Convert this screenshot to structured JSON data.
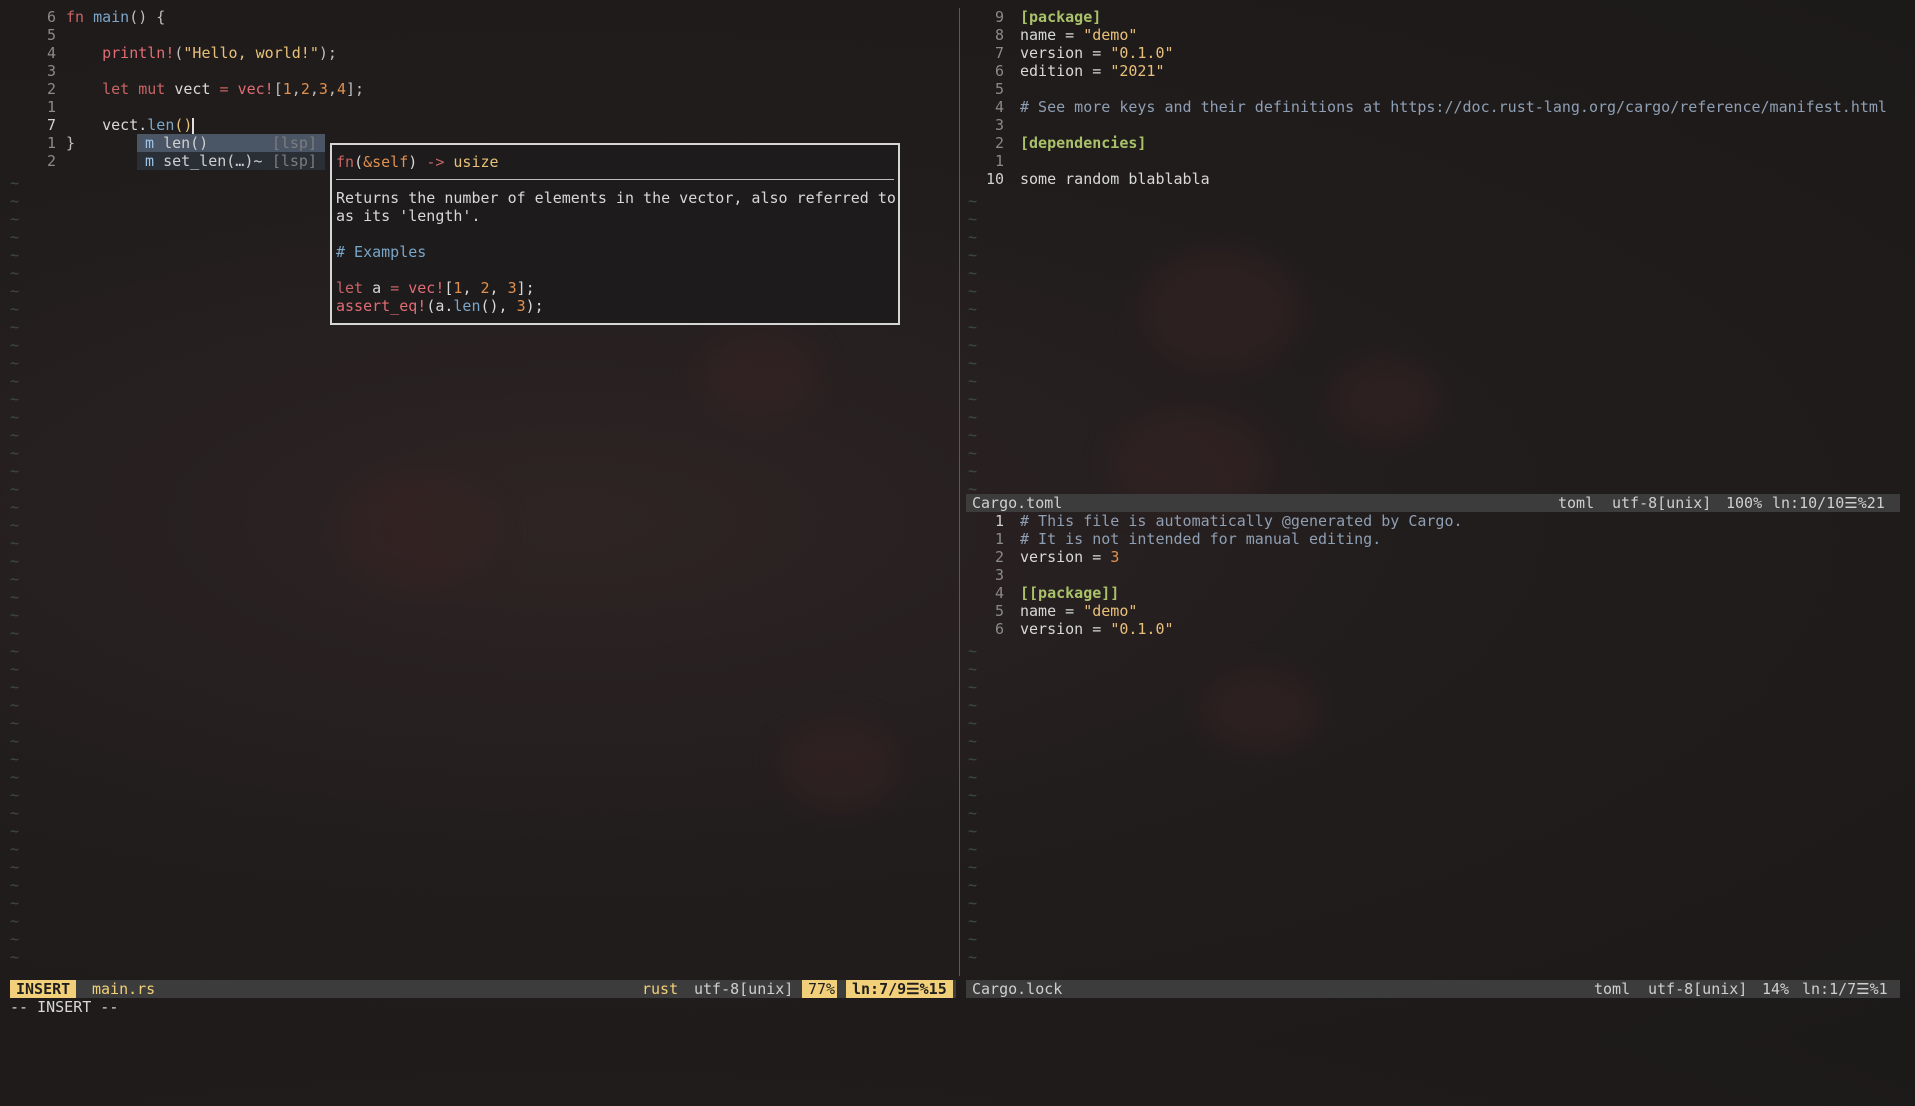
{
  "colors": {
    "accent": "#f2d07a",
    "statusbar": "#3c3c3c",
    "background": "#221d1d"
  },
  "left_pane": {
    "lines": [
      {
        "n": "6",
        "segs": [
          {
            "t": "fn ",
            "c": "kw"
          },
          {
            "t": "main",
            "c": "fn"
          },
          {
            "t": "() {",
            "c": "pun"
          }
        ]
      },
      {
        "n": "5",
        "segs": []
      },
      {
        "n": "4",
        "segs": [
          {
            "t": "    println!",
            "c": "mac"
          },
          {
            "t": "(",
            "c": "pun"
          },
          {
            "t": "\"Hello, world!\"",
            "c": "str"
          },
          {
            "t": ");",
            "c": "pun"
          }
        ]
      },
      {
        "n": "3",
        "segs": []
      },
      {
        "n": "2",
        "segs": [
          {
            "t": "    let mut ",
            "c": "kw"
          },
          {
            "t": "vect ",
            "c": ""
          },
          {
            "t": "= ",
            "c": "kw"
          },
          {
            "t": "vec!",
            "c": "mac"
          },
          {
            "t": "[",
            "c": "pun"
          },
          {
            "t": "1",
            "c": "nm"
          },
          {
            "t": ",",
            "c": "pun"
          },
          {
            "t": "2",
            "c": "nm"
          },
          {
            "t": ",",
            "c": "pun"
          },
          {
            "t": "3",
            "c": "nm"
          },
          {
            "t": ",",
            "c": "pun"
          },
          {
            "t": "4",
            "c": "nm"
          },
          {
            "t": "];",
            "c": "pun"
          }
        ]
      },
      {
        "n": "1",
        "segs": []
      },
      {
        "n": "7",
        "cur": true,
        "segs": [
          {
            "t": "    vect.",
            "c": ""
          },
          {
            "t": "len",
            "c": "fn"
          },
          {
            "t": "()",
            "c": "str"
          }
        ]
      },
      {
        "n": "1",
        "segs": [
          {
            "t": "}",
            "c": "pun"
          }
        ]
      },
      {
        "n": "2",
        "segs": []
      }
    ],
    "tildes": 44
  },
  "completion_menu": [
    {
      "kind": "m",
      "label": "len()",
      "source": "[lsp]",
      "selected": true
    },
    {
      "kind": "m",
      "label": "set_len(…)~",
      "source": "[lsp]",
      "selected": false
    }
  ],
  "doc_popup": {
    "signature": "fn(&self) -> usize",
    "body_line1": "Returns the number of elements in the vector, also referred to",
    "body_line2": "as its 'length'.",
    "examples_heading": "# Examples",
    "example1": "let a = vec![1, 2, 3];",
    "example2": "assert_eq!(a.len(), 3);"
  },
  "right_top": {
    "lines": [
      {
        "n": "9",
        "segs": [
          {
            "t": "[package]",
            "c": "hd"
          }
        ]
      },
      {
        "n": "8",
        "segs": [
          {
            "t": "name = ",
            "c": ""
          },
          {
            "t": "\"demo\"",
            "c": "str"
          }
        ]
      },
      {
        "n": "7",
        "segs": [
          {
            "t": "version = ",
            "c": ""
          },
          {
            "t": "\"0.1.0\"",
            "c": "str"
          }
        ]
      },
      {
        "n": "6",
        "segs": [
          {
            "t": "edition = ",
            "c": ""
          },
          {
            "t": "\"2021\"",
            "c": "str"
          }
        ]
      },
      {
        "n": "5",
        "segs": []
      },
      {
        "n": "4",
        "segs": [
          {
            "t": "# See more keys and their definitions at https://doc.rust-lang.org/cargo/reference/manifest.html",
            "c": "cm"
          }
        ]
      },
      {
        "n": "3",
        "segs": []
      },
      {
        "n": "2",
        "segs": [
          {
            "t": "[dependencies]",
            "c": "hd"
          }
        ]
      },
      {
        "n": "1",
        "segs": []
      },
      {
        "n": "10",
        "cur": true,
        "segs": [
          {
            "t": "some random blablabla",
            "c": ""
          }
        ]
      }
    ],
    "tildes": 17
  },
  "right_bottom": {
    "lines": [
      {
        "n": "1",
        "cur": true,
        "segs": [
          {
            "t": "# This file is automatically @generated by Cargo.",
            "c": "cm"
          }
        ]
      },
      {
        "n": "1",
        "segs": [
          {
            "t": "# It is not intended for manual editing.",
            "c": "cm"
          }
        ]
      },
      {
        "n": "2",
        "segs": [
          {
            "t": "version = ",
            "c": ""
          },
          {
            "t": "3",
            "c": "nm"
          }
        ]
      },
      {
        "n": "3",
        "segs": []
      },
      {
        "n": "4",
        "segs": [
          {
            "t": "[[package]]",
            "c": "hd"
          }
        ]
      },
      {
        "n": "5",
        "segs": [
          {
            "t": "name = ",
            "c": ""
          },
          {
            "t": "\"demo\"",
            "c": "str"
          }
        ]
      },
      {
        "n": "6",
        "segs": [
          {
            "t": "version = ",
            "c": ""
          },
          {
            "t": "\"0.1.0\"",
            "c": "str"
          }
        ]
      }
    ],
    "tildes": 18
  },
  "status_left": {
    "mode": "INSERT",
    "file": "main.rs",
    "filetype": "rust",
    "encoding": "utf-8[unix]",
    "percent": "77%",
    "position": "ln:7/9☰%15"
  },
  "status_cargo_toml": {
    "file": "Cargo.toml",
    "filetype": "toml",
    "encoding": "utf-8[unix]",
    "percent": "100%",
    "position": "ln:10/10☰%21"
  },
  "status_cargo_lock": {
    "file": "Cargo.lock",
    "filetype": "toml",
    "encoding": "utf-8[unix]",
    "percent": "14%",
    "position": "ln:1/7☰%1"
  },
  "cmdline": "-- INSERT --"
}
